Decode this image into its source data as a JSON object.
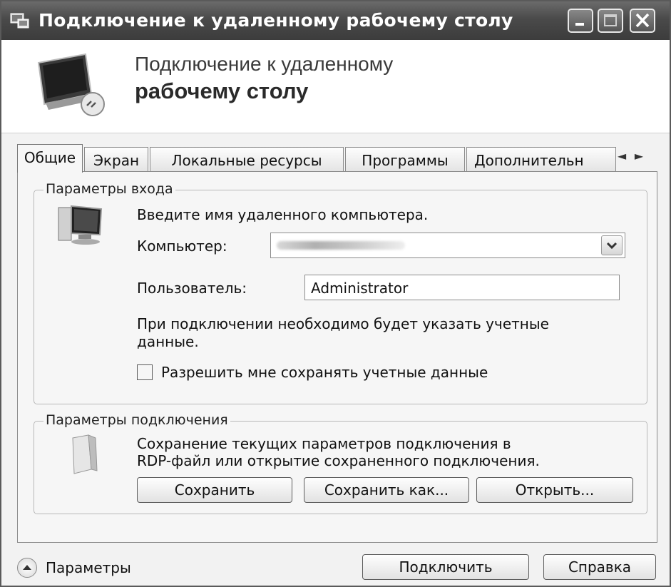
{
  "window": {
    "title": "Подключение к удаленному рабочему столу",
    "icons": {
      "app": "remote-desktop-icon",
      "minimize": "minimize-icon",
      "maximize": "maximize-icon",
      "close": "close-icon"
    }
  },
  "header": {
    "line1": "Подключение к удаленному",
    "line2": "рабочему столу",
    "icon": "monitor-connection-icon"
  },
  "tabs": [
    {
      "label": "Общие",
      "active": true
    },
    {
      "label": "Экран"
    },
    {
      "label": "Локальные ресурсы"
    },
    {
      "label": "Программы"
    },
    {
      "label": "Дополнительн"
    }
  ],
  "tab_scroll": {
    "left": "◄",
    "right": "►"
  },
  "login": {
    "group_title": "Параметры входа",
    "icon": "computer-icon",
    "instruction": "Введите имя удаленного компьютера.",
    "computer_label": "Компьютер:",
    "computer_value": "",
    "user_label": "Пользователь:",
    "user_value": "Administrator",
    "note_line1": "При подключении необходимо будет указать учетные",
    "note_line2": "данные.",
    "save_credentials_label": "Разрешить мне сохранять учетные данные",
    "save_credentials_checked": false
  },
  "connection": {
    "group_title": "Параметры подключения",
    "icon": "folder-icon",
    "desc_line1": "Сохранение текущих параметров подключения в",
    "desc_line2": "RDP-файл или открытие сохраненного подключения.",
    "save_label": "Сохранить",
    "save_as_label": "Сохранить как...",
    "open_label": "Открыть..."
  },
  "footer": {
    "options_label": "Параметры",
    "connect_label": "Подключить",
    "help_label": "Справка"
  }
}
